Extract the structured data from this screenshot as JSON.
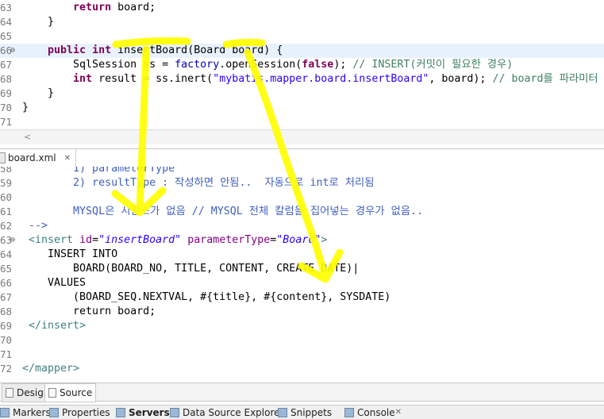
{
  "java_editor": {
    "lines": [
      {
        "num": "63",
        "marker": "",
        "highlight": false,
        "tokens": [
          {
            "t": "        ",
            "c": ""
          },
          {
            "t": "return",
            "c": "kw"
          },
          {
            "t": " board;",
            "c": ""
          }
        ]
      },
      {
        "num": "64",
        "marker": "",
        "highlight": false,
        "tokens": [
          {
            "t": "    }",
            "c": ""
          }
        ]
      },
      {
        "num": "65",
        "marker": "",
        "highlight": false,
        "tokens": []
      },
      {
        "num": "66",
        "marker": "⊖",
        "highlight": true,
        "tokens": [
          {
            "t": "    ",
            "c": ""
          },
          {
            "t": "public",
            "c": "kw"
          },
          {
            "t": " ",
            "c": ""
          },
          {
            "t": "int",
            "c": "kw"
          },
          {
            "t": " insertBoard(Board board) {",
            "c": ""
          }
        ]
      },
      {
        "num": "67",
        "marker": "",
        "highlight": false,
        "tokens": [
          {
            "t": "        SqlSession ",
            "c": ""
          },
          {
            "t": "ss",
            "c": ""
          },
          {
            "t": " = ",
            "c": ""
          },
          {
            "t": "factory",
            "c": "fld"
          },
          {
            "t": ".openSession(",
            "c": ""
          },
          {
            "t": "false",
            "c": "kw"
          },
          {
            "t": "); ",
            "c": ""
          },
          {
            "t": "// INSERT(커밋이 필요한 경우)",
            "c": "cm"
          }
        ]
      },
      {
        "num": "68",
        "marker": "",
        "highlight": false,
        "tokens": [
          {
            "t": "        ",
            "c": ""
          },
          {
            "t": "int",
            "c": "kw"
          },
          {
            "t": " result = ss.inert(",
            "c": ""
          },
          {
            "t": "\"mybatis.mapper.board.insertBoard\"",
            "c": "str"
          },
          {
            "t": ", board); ",
            "c": ""
          },
          {
            "t": "// board를 파라미터",
            "c": "cm"
          }
        ]
      },
      {
        "num": "69",
        "marker": "",
        "highlight": false,
        "tokens": [
          {
            "t": "    }",
            "c": ""
          }
        ]
      },
      {
        "num": "70",
        "marker": "",
        "highlight": false,
        "tokens": [
          {
            "t": "}",
            "c": ""
          }
        ]
      },
      {
        "num": "71",
        "marker": "",
        "highlight": false,
        "tokens": []
      }
    ],
    "scroll_left_arrow": "<"
  },
  "xml_tab": {
    "label": "board.xml",
    "close": "✕"
  },
  "xml_editor": {
    "lines": [
      {
        "num": "58",
        "marker": "",
        "tokens": [
          {
            "t": "        1) parameterType",
            "c": "xcm"
          }
        ]
      },
      {
        "num": "59",
        "marker": "",
        "tokens": [
          {
            "t": "        2) resultType : 작성하면 안됨..  자동으로 int로 처리됨",
            "c": "xcm"
          }
        ]
      },
      {
        "num": "60",
        "marker": "",
        "tokens": []
      },
      {
        "num": "61",
        "marker": "",
        "tokens": [
          {
            "t": "        MYSQL은 시퀀스가 없음 // MYSQL 전체 칼럼을 집어넣는 경우가 없음..",
            "c": "xcm"
          }
        ]
      },
      {
        "num": "62",
        "marker": "",
        "tokens": [
          {
            "t": " -->",
            "c": "xcm"
          }
        ]
      },
      {
        "num": "63",
        "marker": "⊖",
        "tokens": [
          {
            "t": " <",
            "c": "xtag"
          },
          {
            "t": "insert",
            "c": "xtag"
          },
          {
            "t": " ",
            "c": ""
          },
          {
            "t": "id",
            "c": "xattr"
          },
          {
            "t": "=",
            "c": ""
          },
          {
            "t": "\"insertBoard\"",
            "c": "xval"
          },
          {
            "t": " ",
            "c": ""
          },
          {
            "t": "parameterType",
            "c": "xattr"
          },
          {
            "t": "=",
            "c": ""
          },
          {
            "t": "\"Board\"",
            "c": "xval"
          },
          {
            "t": ">",
            "c": "xtag"
          }
        ]
      },
      {
        "num": "64",
        "marker": "",
        "tokens": [
          {
            "t": "    INSERT INTO",
            "c": ""
          }
        ]
      },
      {
        "num": "65",
        "marker": "",
        "tokens": [
          {
            "t": "        BOARD(BOARD_NO, TITLE, CONTENT, CREATE_DATE)|",
            "c": ""
          }
        ]
      },
      {
        "num": "66",
        "marker": "",
        "tokens": [
          {
            "t": "    VALUES",
            "c": ""
          }
        ]
      },
      {
        "num": "67",
        "marker": "",
        "tokens": [
          {
            "t": "        (BOARD_SEQ.NEXTVAL, #{title}, #{content}, SYSDATE)",
            "c": ""
          }
        ]
      },
      {
        "num": "68",
        "marker": "",
        "tokens": [
          {
            "t": "        return board;",
            "c": ""
          }
        ]
      },
      {
        "num": "69",
        "marker": "",
        "tokens": [
          {
            "t": " </",
            "c": "xtag"
          },
          {
            "t": "insert",
            "c": "xtag"
          },
          {
            "t": ">",
            "c": "xtag"
          }
        ]
      },
      {
        "num": "70",
        "marker": "",
        "tokens": []
      },
      {
        "num": "71",
        "marker": "",
        "tokens": []
      },
      {
        "num": "72",
        "marker": "",
        "tokens": [
          {
            "t": "</",
            "c": "xtag"
          },
          {
            "t": "mapper",
            "c": "xtag"
          },
          {
            "t": ">",
            "c": "xtag"
          }
        ]
      }
    ]
  },
  "editor_mode_tabs": [
    {
      "label": "Design",
      "icon": "design-icon"
    },
    {
      "label": "Source",
      "icon": "source-icon"
    }
  ],
  "bottom_views": [
    {
      "label": "Markers",
      "icon": "markers-icon"
    },
    {
      "label": "Properties",
      "icon": "properties-icon"
    },
    {
      "label": "Servers",
      "icon": "servers-icon",
      "active": true
    },
    {
      "label": "Data Source Explorer",
      "icon": "data-source-icon"
    },
    {
      "label": "Snippets",
      "icon": "snippets-icon"
    },
    {
      "label": "Console",
      "icon": "console-icon"
    }
  ],
  "colors": {
    "highlight_line": "#e8f2fe",
    "annotation_yellow": "#ffff00",
    "keyword": "#7f0055",
    "comment": "#3f7f5f",
    "string": "#2a00ff"
  }
}
